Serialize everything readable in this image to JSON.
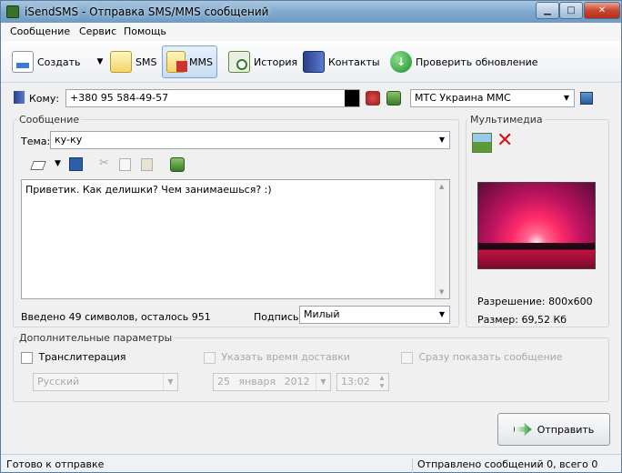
{
  "window": {
    "title": "iSendSMS - Отправка SMS/MMS сообщений"
  },
  "menu": [
    "Сообщение",
    "Сервис",
    "Помощь"
  ],
  "toolbar": {
    "create": "Создать",
    "sms": "SMS",
    "mms": "MMS",
    "history": "История",
    "contacts": "Контакты",
    "update": "Проверить обновление"
  },
  "recipient": {
    "label": "Кому:",
    "value": "+380 95 584-49-57",
    "operator": "МТС Украина ММС"
  },
  "message": {
    "group_label": "Сообщение",
    "subject_label": "Тема:",
    "subject": "ку-ку",
    "body": "Приветик. Как делишки? Чем занимаешься? :)",
    "counter": "Введено 49 символов, осталось 951",
    "signature_label": "Подпись",
    "signature": "Милый"
  },
  "multimedia": {
    "group_label": "Мультимедиа",
    "resolution": "Разрешение: 800x600",
    "size": "Размер: 69,52 Кб"
  },
  "extra": {
    "group_label": "Дополнительные параметры",
    "translit_label": "Транслитерация",
    "language": "Русский",
    "delivery_time_label": "Указать время доставки",
    "date_day": "25",
    "date_month": "января",
    "date_year": "2012",
    "time": "13:02",
    "show_now_label": "Сразу показать сообщение"
  },
  "send_button": "Отправить",
  "status": {
    "left": "Готово к отправке",
    "right": "Отправлено сообщений 0, всего 0"
  },
  "colors": {
    "accent": "#7da2ce",
    "title_bar": "#7fa9cf"
  }
}
